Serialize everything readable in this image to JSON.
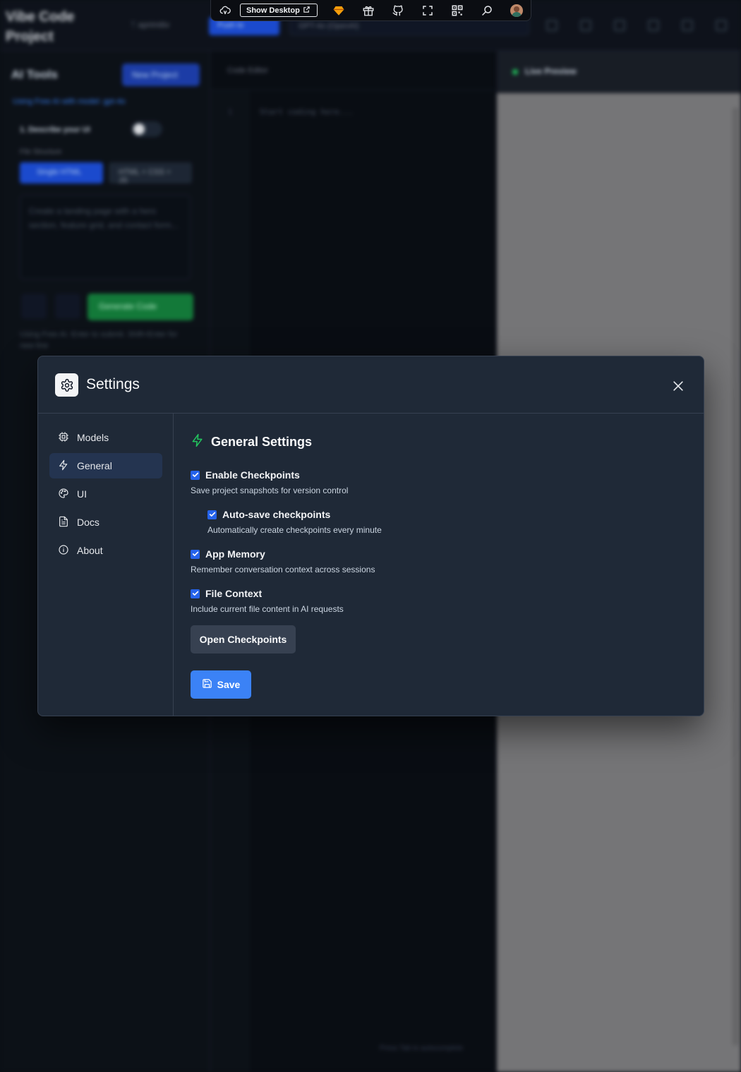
{
  "background": {
    "app_title": "Vibe Code Project",
    "branch": "ᛘ aprimitiv",
    "push_label": "Push to",
    "model_select": "GPT-4o (OpenAI)",
    "left_title": "AI Tools",
    "new_project": "New Project",
    "hint": "Using Free AI with model: gpt-4o",
    "step": "1. Describe your UI",
    "file_structure_label": "File Structure",
    "seg_single": "Single HTML",
    "seg_multi": "HTML + CSS + JS",
    "prompt_placeholder": "Create a landing page with a hero section, feature grid, and contact form...",
    "generate_label": "Generate Code",
    "footer_hint": "Using Free AI. Enter to submit. Shift+Enter for new line",
    "editor_title": "Code Editor",
    "code_placeholder": "Start coding here...",
    "editor_footer": "Press Tab to autocomplete",
    "preview_title": "Live Preview"
  },
  "toolbar": {
    "show_desktop": "Show Desktop",
    "icons": [
      "cloud-icon",
      "external-link-icon",
      "gem-icon",
      "gift-icon",
      "github-icon",
      "fullscreen-icon",
      "qr-code-icon",
      "search-icon",
      "avatar"
    ]
  },
  "modal": {
    "title": "Settings",
    "nav": [
      {
        "label": "Models",
        "icon": "cpu-icon"
      },
      {
        "label": "General",
        "icon": "zap-icon",
        "active": true
      },
      {
        "label": "UI",
        "icon": "palette-icon"
      },
      {
        "label": "Docs",
        "icon": "document-icon"
      },
      {
        "label": "About",
        "icon": "info-icon"
      }
    ],
    "section_title": "General Settings",
    "options": [
      {
        "label": "Enable Checkpoints",
        "desc": "Save project snapshots for version control",
        "checked": true
      },
      {
        "label": "Auto-save checkpoints",
        "desc": "Automatically create checkpoints every minute",
        "checked": true
      },
      {
        "label": "App Memory",
        "desc": "Remember conversation context across sessions",
        "checked": true
      },
      {
        "label": "File Context",
        "desc": "Include current file content in AI requests",
        "checked": true
      }
    ],
    "open_checkpoints": "Open Checkpoints",
    "save": "Save"
  },
  "colors": {
    "modal_bg": "#1f2937",
    "accent_blue": "#3b82f6",
    "zap_green": "#22c55e",
    "active_nav": "#243450"
  }
}
